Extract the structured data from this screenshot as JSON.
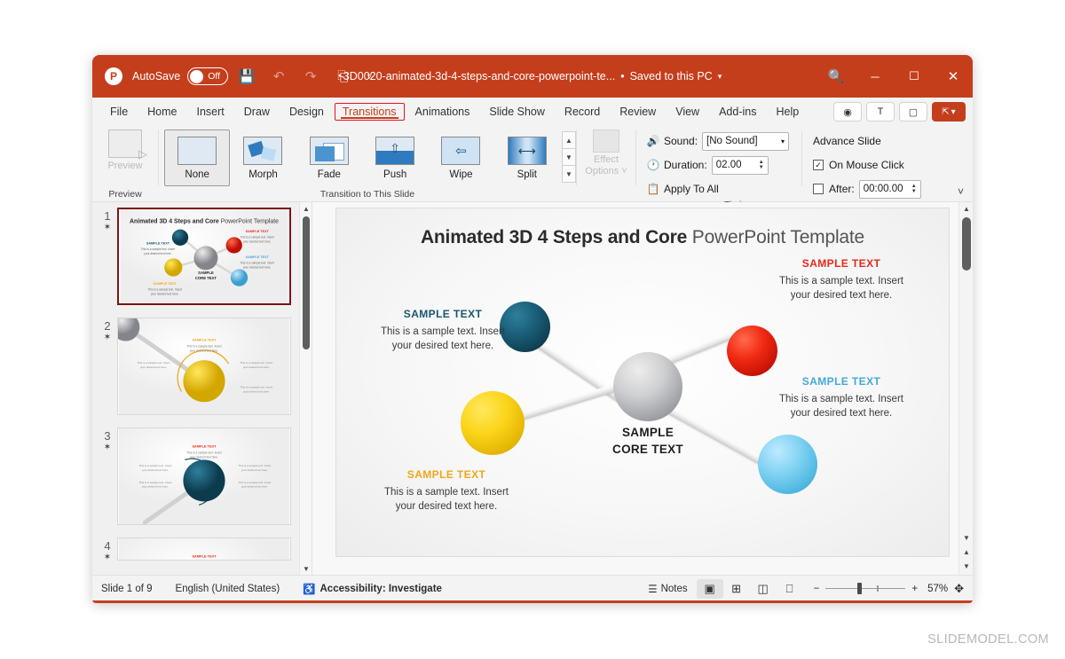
{
  "titlebar": {
    "app_logo": "powerpoint-logo",
    "autosave_label": "AutoSave",
    "autosave_state": "Off",
    "save_icon": "save-icon",
    "undo_icon": "undo-icon",
    "redo_icon": "redo-icon",
    "present_icon": "start-presentation-icon",
    "customize_icon": "customize-quick-access-icon",
    "document_name": "3D0020-animated-3d-4-steps-and-core-powerpoint-te...",
    "save_location": "Saved to this PC",
    "search_icon": "search-icon",
    "minimize": "minimize-icon",
    "maximize": "maximize-icon",
    "close": "close-icon",
    "bg_color": "#c43e1c"
  },
  "ribbon_tabs": {
    "items": [
      {
        "label": "File",
        "active": false
      },
      {
        "label": "Home",
        "active": false
      },
      {
        "label": "Insert",
        "active": false
      },
      {
        "label": "Draw",
        "active": false
      },
      {
        "label": "Design",
        "active": false
      },
      {
        "label": "Transitions",
        "active": true
      },
      {
        "label": "Animations",
        "active": false
      },
      {
        "label": "Slide Show",
        "active": false
      },
      {
        "label": "Record",
        "active": false
      },
      {
        "label": "Review",
        "active": false
      },
      {
        "label": "View",
        "active": false
      },
      {
        "label": "Add-ins",
        "active": false
      },
      {
        "label": "Help",
        "active": false
      }
    ],
    "active_tab_color": "#c43e1c",
    "highlight_border_color": "#e81123",
    "right_buttons": [
      {
        "name": "record-button",
        "glyph": "◉"
      },
      {
        "name": "teams-button",
        "glyph": "T"
      },
      {
        "name": "comments-button",
        "glyph": "▢"
      }
    ],
    "share_label": "Share"
  },
  "ribbon": {
    "preview_group": {
      "button_label": "Preview",
      "group_title": "Preview"
    },
    "transitions_group": {
      "group_title": "Transition to This Slide",
      "items": [
        {
          "label": "None",
          "selected": true
        },
        {
          "label": "Morph",
          "selected": false
        },
        {
          "label": "Fade",
          "selected": false
        },
        {
          "label": "Push",
          "selected": false
        },
        {
          "label": "Wipe",
          "selected": false
        },
        {
          "label": "Split",
          "selected": false
        }
      ],
      "scroll_up": "▲",
      "scroll_down": "▼",
      "scroll_more": "▼"
    },
    "effect_options": {
      "line1": "Effect",
      "line2": "Options ˅"
    },
    "timing_group": {
      "group_title": "Timing",
      "sound_label": "Sound:",
      "sound_value": "[No Sound]",
      "duration_label": "Duration:",
      "duration_value": "02.00",
      "apply_to_all_label": "Apply To All",
      "advance_slide_label": "Advance Slide",
      "on_mouse_click_label": "On Mouse Click",
      "on_mouse_click_checked": true,
      "after_label": "After:",
      "after_value": "00:00.00",
      "after_checked": false
    },
    "collapse_glyph": "˅"
  },
  "thumbnails": {
    "slides": [
      {
        "number": "1",
        "star": "✶",
        "active": true
      },
      {
        "number": "2",
        "star": "✶",
        "active": false
      },
      {
        "number": "3",
        "star": "✶",
        "active": false
      },
      {
        "number": "4",
        "star": "✶",
        "active": false
      }
    ],
    "scroll_up": "▲",
    "scroll_down": "▼"
  },
  "slide": {
    "title_bold": "Animated 3D 4 Steps and Core",
    "title_light": " PowerPoint Template",
    "core_line1": "SAMPLE",
    "core_line2": "CORE TEXT",
    "body_text_line1": "This is a sample text. Insert",
    "body_text_line2": "your desired text here.",
    "labels": [
      {
        "id": "top-left",
        "text": "SAMPLE TEXT",
        "color": "#1b5670"
      },
      {
        "id": "top-right",
        "text": "SAMPLE TEXT",
        "color": "#e8271a"
      },
      {
        "id": "bottom-right",
        "text": "SAMPLE TEXT",
        "color": "#43a9d8"
      },
      {
        "id": "bottom-left",
        "text": "SAMPLE TEXT",
        "color": "#f0a71b"
      }
    ],
    "sphere_colors": {
      "teal": "#1a5e78",
      "red": "#f02a12",
      "yellow": "#fbd51a",
      "blue": "#7fd2f2",
      "core": "#b5b6ba"
    },
    "scroll_up": "▲",
    "scroll_down": "▼",
    "prev_slide": "▲",
    "next_slide": "▼"
  },
  "statusbar": {
    "slide_counter": "Slide 1 of 9",
    "language": "English (United States)",
    "accessibility_icon": "accessibility-icon",
    "accessibility": "Accessibility: Investigate",
    "notes_label": "Notes",
    "views": [
      {
        "name": "normal-view",
        "glyph": "▣",
        "active": true
      },
      {
        "name": "slide-sorter-view",
        "glyph": "⊞",
        "active": false
      },
      {
        "name": "reading-view",
        "glyph": "◫",
        "active": false
      },
      {
        "name": "slide-show-view",
        "glyph": "⎕",
        "active": false
      }
    ],
    "zoom_out": "−",
    "zoom_in": "+",
    "zoom_level": "57%",
    "fit_icon": "fit-to-window-icon"
  },
  "watermark": "SLIDEMODEL.COM"
}
